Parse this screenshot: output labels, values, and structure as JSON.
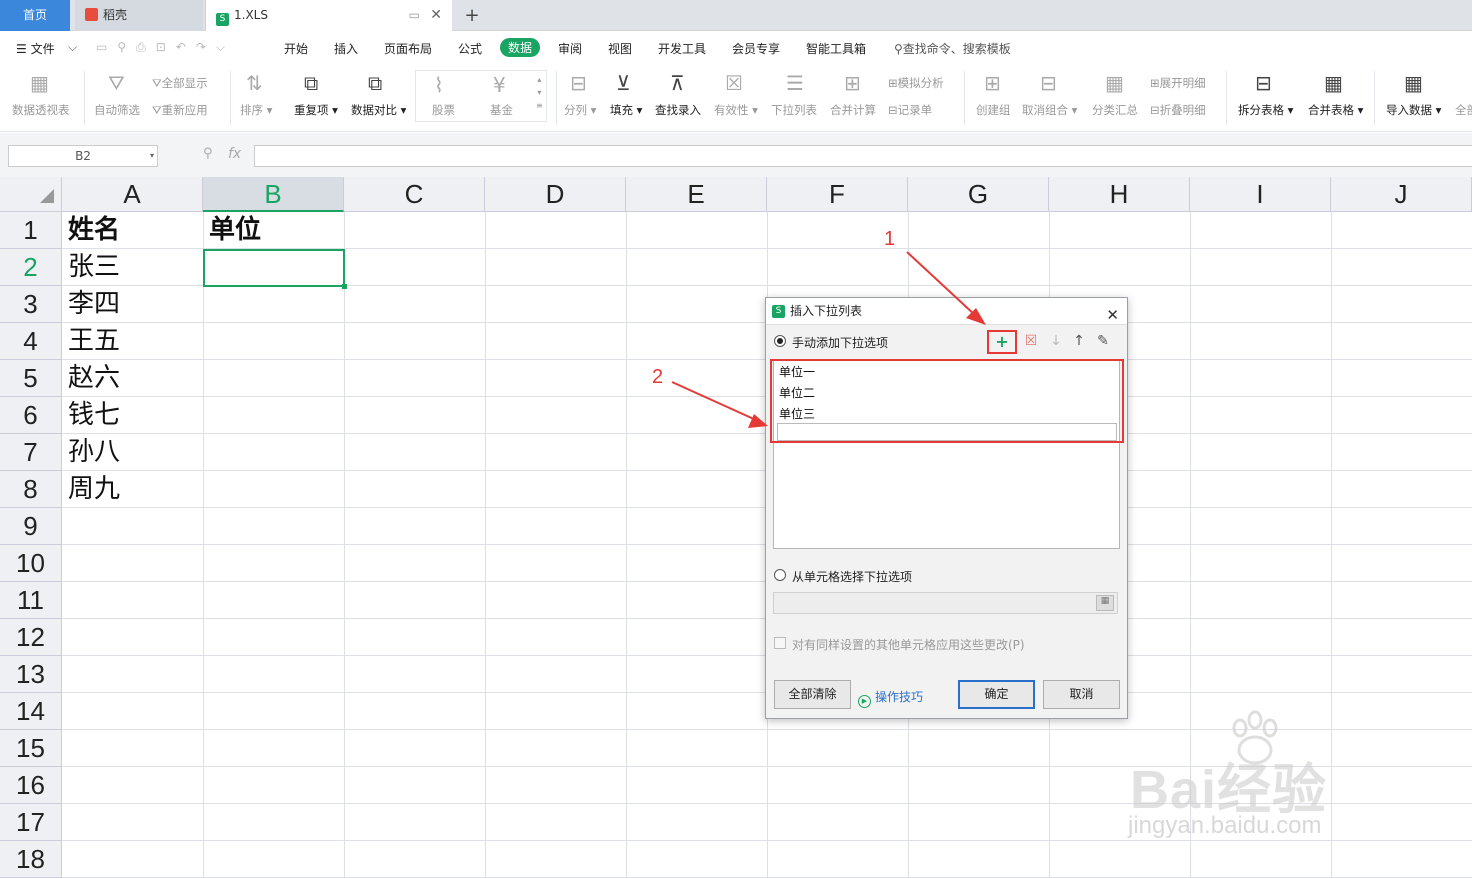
{
  "tabs": {
    "home": "首页",
    "daoke": "稻壳",
    "file": "1.XLS",
    "add": "+",
    "close": "✕",
    "pin": "▭"
  },
  "menus": {
    "file": "☰ 文件",
    "items": [
      "开始",
      "插入",
      "页面布局",
      "公式",
      "数据",
      "审阅",
      "视图",
      "开发工具",
      "会员专享",
      "智能工具箱"
    ],
    "search": "查找命令、搜索模板"
  },
  "ribbon": {
    "pivot": "数据透视表",
    "autofilter": "自动筛选",
    "showall": "全部显示",
    "reapply": "重新应用",
    "sort": "排序",
    "duplicates": "重复项",
    "compare": "数据对比",
    "stock": "股票",
    "fund": "基金",
    "split": "分列",
    "fill": "填充",
    "lookup": "查找录入",
    "validity": "有效性",
    "dropdown": "下拉列表",
    "mergecalc": "合并计算",
    "simulate": "模拟分析",
    "record": "记录单",
    "group": "创建组",
    "ungroup": "取消组合",
    "subtotal": "分类汇总",
    "expand": "展开明细",
    "collapse": "折叠明细",
    "splittable": "拆分表格",
    "mergetable": "合并表格",
    "import": "导入数据",
    "more": "全部"
  },
  "formula": {
    "namebox": "B2",
    "fx": "fx"
  },
  "columns": [
    "A",
    "B",
    "C",
    "D",
    "E",
    "F",
    "G",
    "H",
    "I",
    "J"
  ],
  "rows": [
    "1",
    "2",
    "3",
    "4",
    "5",
    "6",
    "7",
    "8",
    "9",
    "10",
    "11",
    "12",
    "13",
    "14",
    "15",
    "16",
    "17",
    "18"
  ],
  "cells": {
    "A1": "姓名",
    "B1": "单位",
    "A2": "张三",
    "A3": "李四",
    "A4": "王五",
    "A5": "赵六",
    "A6": "钱七",
    "A7": "孙八",
    "A8": "周九"
  },
  "dialog": {
    "title": "插入下拉列表",
    "logo": "S",
    "manual": "手动添加下拉选项",
    "items": [
      "单位一",
      "单位二",
      "单位三"
    ],
    "from_cell": "从单元格选择下拉选项",
    "apply_all": "对有同样设置的其他单元格应用这些更改(P)",
    "clear_all": "全部清除",
    "tips": "操作技巧",
    "ok": "确定",
    "cancel": "取消"
  },
  "annotations": {
    "one": "1",
    "two": "2"
  },
  "watermark": {
    "brand": "Bai经验",
    "url": "jingyan.baidu.com"
  },
  "colors": {
    "accent": "#19a463",
    "annotation": "#e53935",
    "home_tab": "#3a87dc"
  }
}
